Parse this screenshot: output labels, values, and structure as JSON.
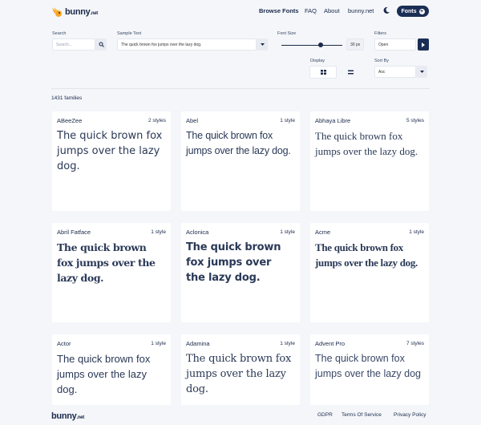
{
  "header": {
    "logo_text": "bunny",
    "logo_suffix": ".net",
    "nav": [
      "Browse Fonts",
      "FAQ",
      "About",
      "bunny.net"
    ],
    "fonts_button": "Fonts"
  },
  "filters": {
    "search_label": "Search",
    "search_placeholder": "Search...",
    "sample_label": "Sample Text",
    "sample_value": "The quick brown fox jumps over the lazy dog.",
    "size_label": "Font Size",
    "size_value": "30 px",
    "size_fraction": 0.64,
    "filters_label": "Filters",
    "filters_value": "Open",
    "display_label": "Display",
    "sort_label": "Sort By",
    "sort_value": "Asc"
  },
  "count": "1431 families",
  "cards": [
    {
      "name": "ABeeZee",
      "styles": "2 styles",
      "sample": "The quick brown fox jumps over the lazy dog."
    },
    {
      "name": "Abel",
      "styles": "1 style",
      "sample": "The quick brown fox jumps over the lazy dog."
    },
    {
      "name": "Abhaya Libre",
      "styles": "5 styles",
      "sample": "The quick brown fox jumps over the lazy dog."
    },
    {
      "name": "Abril Fatface",
      "styles": "1 style",
      "sample": "The quick brown fox jumps over the lazy dog."
    },
    {
      "name": "Aclonica",
      "styles": "1 style",
      "sample": "The quick brown fox jumps over the lazy dog."
    },
    {
      "name": "Acme",
      "styles": "1 style",
      "sample": "The quick brown fox jumps over the lazy dog."
    },
    {
      "name": "Actor",
      "styles": "1 style",
      "sample": "The quick brown fox jumps over the lazy dog."
    },
    {
      "name": "Adamina",
      "styles": "1 style",
      "sample": "The quick brown fox jumps over the lazy dog."
    },
    {
      "name": "Advent Pro",
      "styles": "7 styles",
      "sample": "The quick brown fox jumps over the lazy dog"
    }
  ],
  "footer": {
    "logo_text": "bunny",
    "logo_suffix": ".net",
    "links": [
      "GDPR",
      "Terms Of Service",
      "Privacy Policy"
    ]
  },
  "colors": {
    "brand": "#1b2e54",
    "accent": "#f5a623",
    "background": "#f4f6fa"
  },
  "icons": {
    "logo": "bunny-logo-icon",
    "theme": "moon-icon",
    "search": "search-icon",
    "dropdown": "chevron-down-icon",
    "next": "chevron-right-icon",
    "grid": "grid-view-icon",
    "list": "list-view-icon"
  }
}
